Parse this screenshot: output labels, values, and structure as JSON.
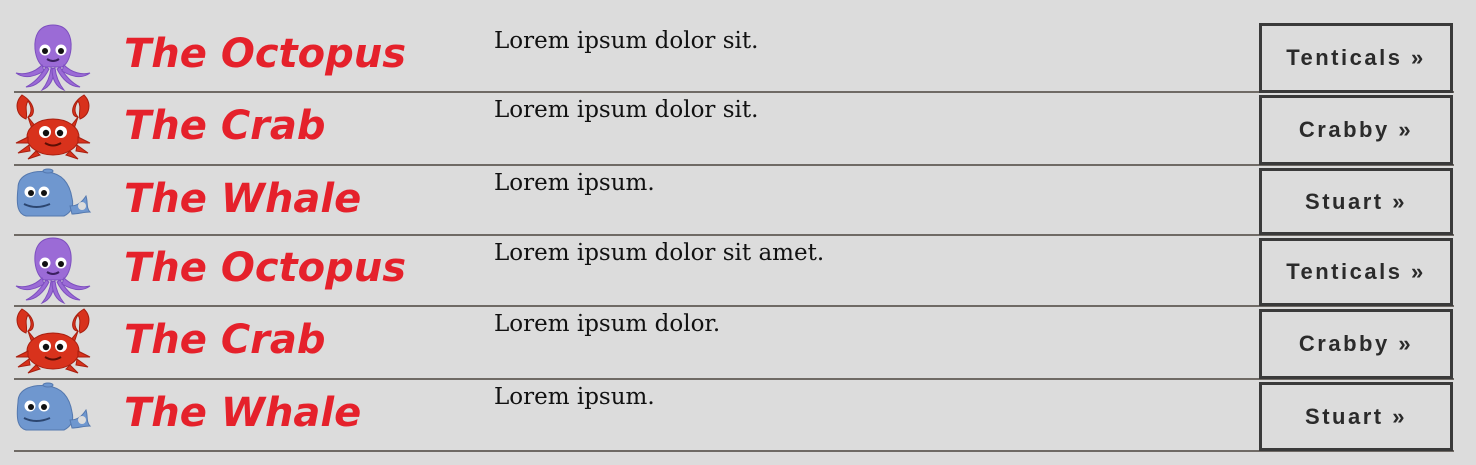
{
  "rows": [
    {
      "icon": "octopus-icon",
      "name": "The Octopus",
      "desc": "Lorem ipsum dolor sit.",
      "button": "Tenticals »"
    },
    {
      "icon": "crab-icon",
      "name": "The Crab",
      "desc": "Lorem ipsum dolor sit.",
      "button": "Crabby »"
    },
    {
      "icon": "whale-icon",
      "name": "The Whale",
      "desc": "Lorem ipsum.",
      "button": "Stuart »"
    },
    {
      "icon": "octopus-icon",
      "name": "The Octopus",
      "desc": "Lorem ipsum dolor sit amet.",
      "button": "Tenticals »"
    },
    {
      "icon": "crab-icon",
      "name": "The Crab",
      "desc": "Lorem ipsum dolor.",
      "button": "Crabby »"
    },
    {
      "icon": "whale-icon",
      "name": "The Whale",
      "desc": "Lorem ipsum.",
      "button": "Stuart »"
    }
  ],
  "colors": {
    "background": "#dcdcdc",
    "name_text": "#e5212b",
    "divider": "#6f6a65",
    "button_border": "#3a3a3a",
    "octopus": "#9b6bd6",
    "crab": "#d8321c",
    "whale": "#6f97cf"
  }
}
